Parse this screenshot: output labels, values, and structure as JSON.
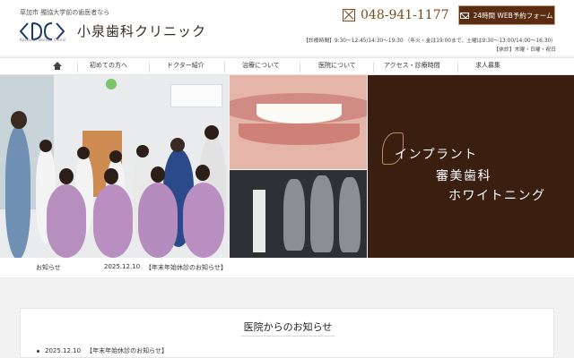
{
  "header": {
    "tagline": "草加市 獨協大学前の歯医者なら",
    "logo_text": "Koizumi Dental Clinic",
    "clinic_name": "小泉歯科クリニック",
    "phone": "048-941-1177",
    "web_button": "24時間 WEB予約フォーム",
    "hours_line1": "【診療時間】9:30～12:45/14:30～19:30 （年火・金は19:00まで、土曜は9:30～13:00/14:00～16:30）",
    "hours_line2": "【休診】木曜・日曜・祝日"
  },
  "nav": {
    "items": [
      {
        "label": "初めての方へ"
      },
      {
        "label": "ドクター紹介"
      },
      {
        "label": "治療について"
      },
      {
        "label": "医院について"
      },
      {
        "label": "アクセス・診療時間"
      },
      {
        "label": "求人募集"
      }
    ]
  },
  "hero": {
    "promo_lines": [
      "インプラント",
      "審美歯科",
      "ホワイトニング"
    ]
  },
  "news": {
    "label": "お知らせ",
    "date": "2025.12.10",
    "title": "【年末年始休診のお知らせ】"
  },
  "panel": {
    "title": "医院からのお知らせ",
    "items": [
      {
        "date": "2025.12.10",
        "title": "【年末年始休診のお知らせ】"
      }
    ]
  },
  "colors": {
    "brand_brown": "#5a2d12",
    "promo_bg": "#3a1f10",
    "accent": "#7b4a1e"
  }
}
